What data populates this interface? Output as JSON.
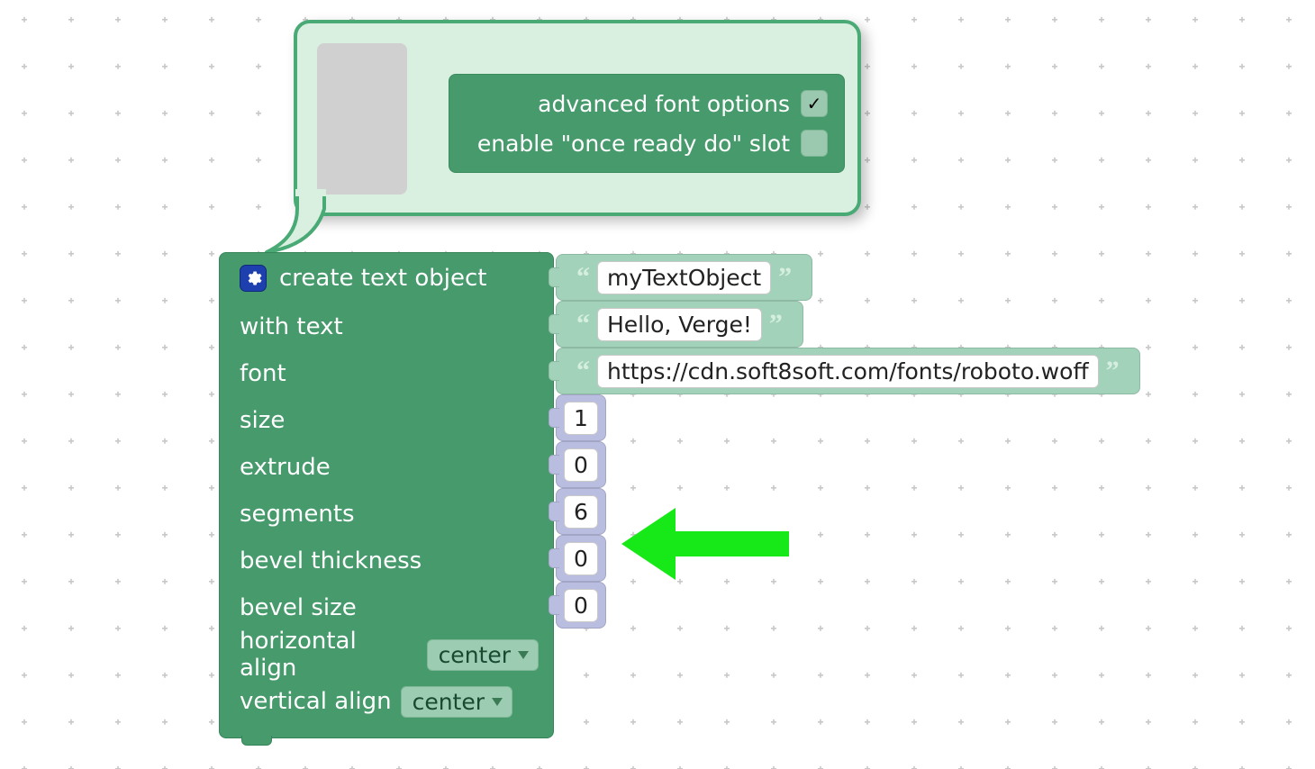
{
  "mutator": {
    "options": [
      {
        "label": "advanced font options",
        "checked": true
      },
      {
        "label": "enable \"once ready do\" slot",
        "checked": false
      }
    ]
  },
  "block": {
    "title": "create text object",
    "rows": {
      "with_text": "with text",
      "font": "font",
      "size": "size",
      "extrude": "extrude",
      "segments": "segments",
      "bevel_thickness": "bevel thickness",
      "bevel_size": "bevel size",
      "horizontal_align": "horizontal align",
      "vertical_align": "vertical align"
    },
    "dropdowns": {
      "h_align": "center",
      "v_align": "center"
    }
  },
  "inputs": {
    "name": "myTextObject",
    "text": "Hello, Verge!",
    "font": "https://cdn.soft8soft.com/fonts/roboto.woff",
    "size": "1",
    "extrude": "0",
    "segments": "6",
    "bevel_thickness": "0",
    "bevel_size": "0"
  },
  "colors": {
    "block_green": "#479a6c",
    "light_green": "#a2d3ba",
    "bubble_bg": "#d9efe0",
    "number_purple": "#b9bde0",
    "arrow_green": "#17e817"
  }
}
